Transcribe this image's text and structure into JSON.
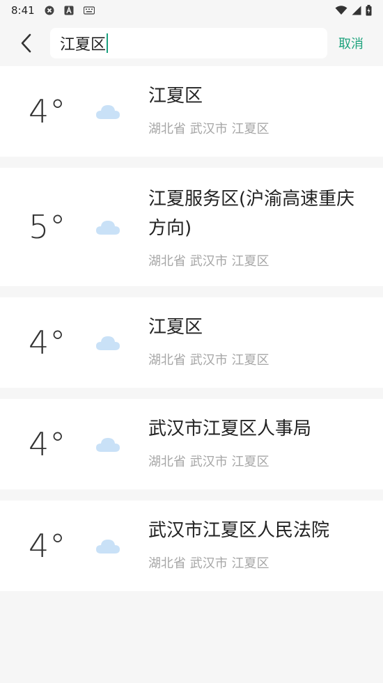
{
  "status_bar": {
    "time": "8:41",
    "icons": [
      "notification-x-icon",
      "text-a-icon",
      "keyboard-icon",
      "wifi-icon",
      "signal-icon",
      "battery-icon"
    ]
  },
  "header": {
    "search_value": "江夏区",
    "cancel_label": "取消",
    "accent_color": "#1ea37d"
  },
  "results": [
    {
      "temp": "4°",
      "name": "江夏区",
      "region": "湖北省 武汉市 江夏区",
      "icon": "cloud-icon"
    },
    {
      "temp": "5°",
      "name": "江夏服务区(沪渝高速重庆方向)",
      "region": "湖北省 武汉市 江夏区",
      "icon": "cloud-icon"
    },
    {
      "temp": "4°",
      "name": "江夏区",
      "region": "湖北省 武汉市 江夏区",
      "icon": "cloud-icon"
    },
    {
      "temp": "4°",
      "name": "武汉市江夏区人事局",
      "region": "湖北省 武汉市 江夏区",
      "icon": "cloud-icon"
    },
    {
      "temp": "4°",
      "name": "武汉市江夏区人民法院",
      "region": "湖北省 武汉市 江夏区",
      "icon": "cloud-icon"
    }
  ]
}
